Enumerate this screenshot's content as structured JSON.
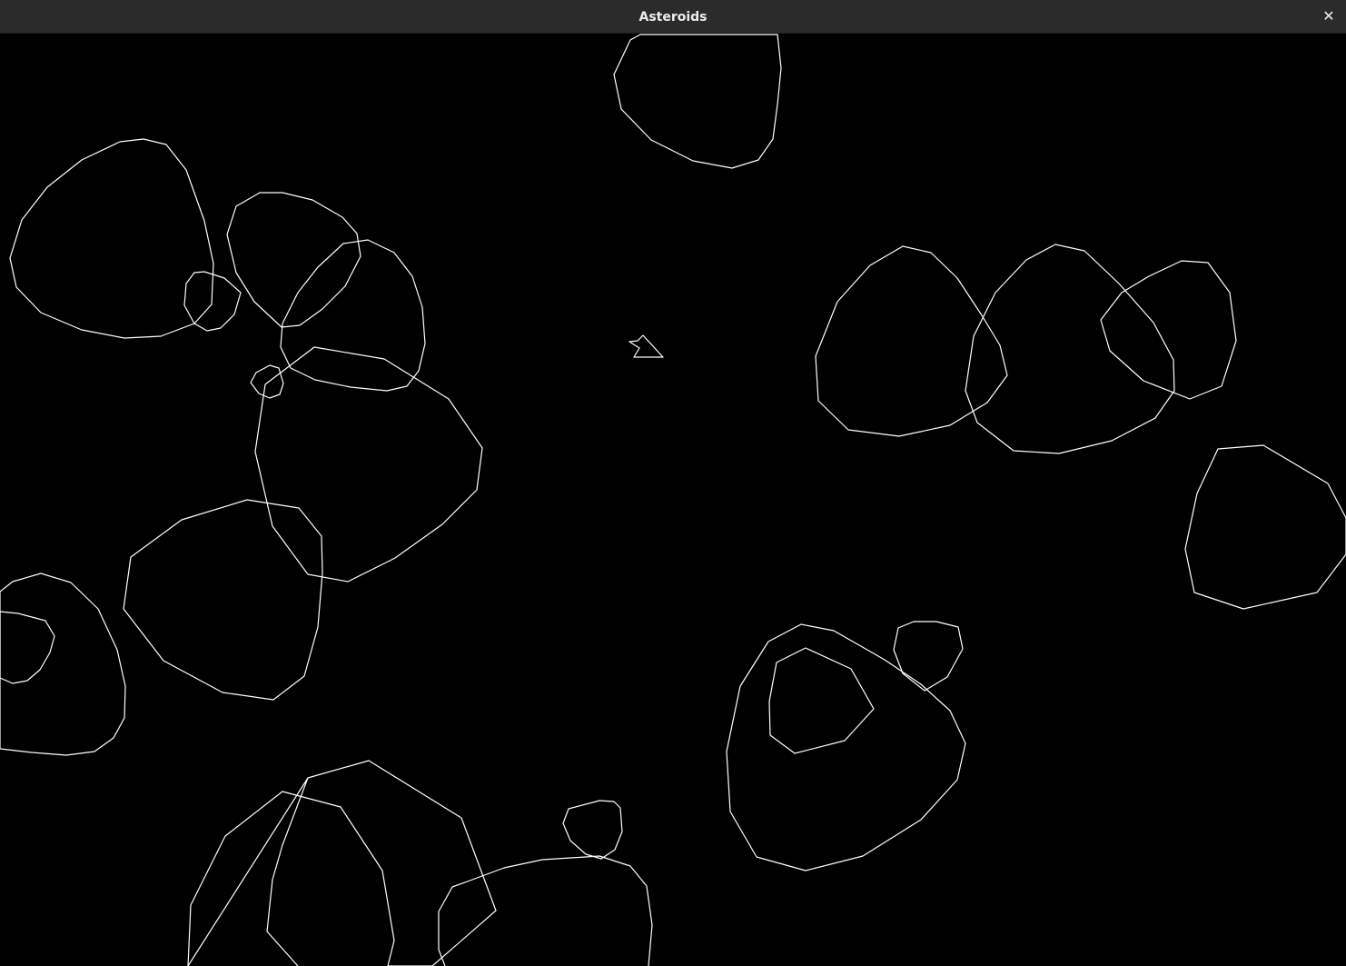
{
  "window": {
    "title": "Asteroids",
    "close_glyph": "✕"
  },
  "colors": {
    "background": "#000000",
    "stroke": "#ffffff",
    "titlebar": "#2b2b2b",
    "title_text": "#ededed"
  },
  "icons": {
    "close": "close-icon",
    "ship": "ship-icon"
  }
}
